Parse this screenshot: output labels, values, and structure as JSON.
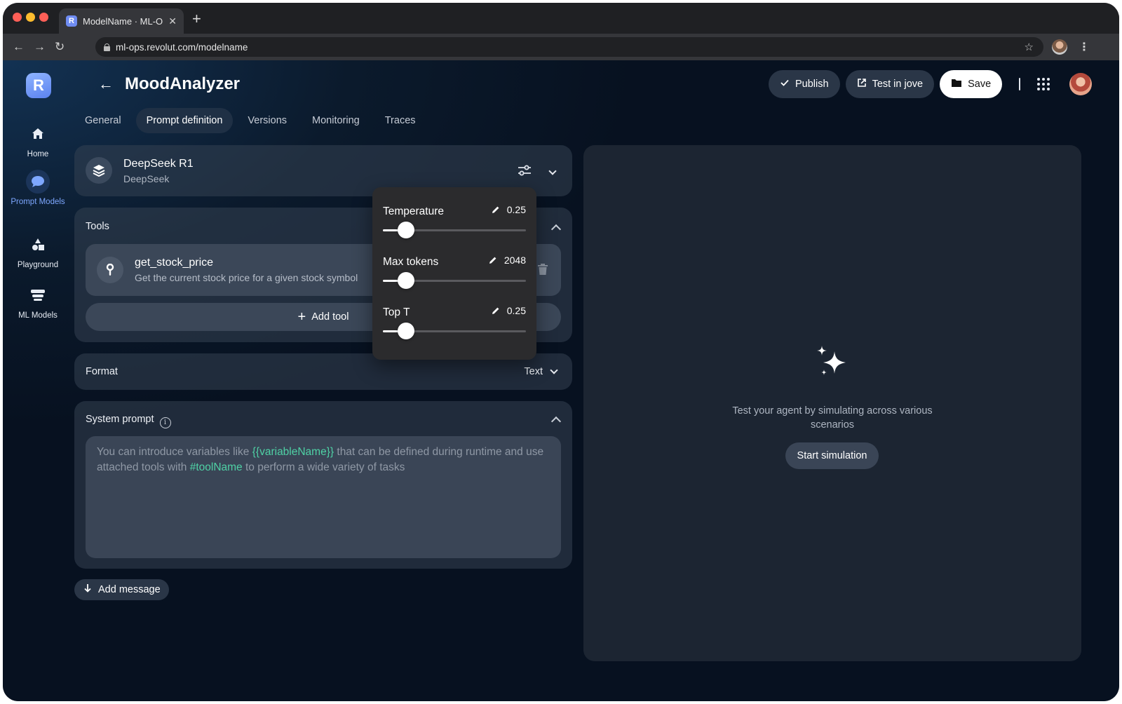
{
  "browser": {
    "tab_title": "ModelName · ML-Ops",
    "favicon_letter": "R",
    "url": "ml-ops.revolut.com/modelname",
    "new_tab": "+",
    "close_tab": "✕"
  },
  "sidebar": {
    "logo": "R",
    "items": [
      {
        "label": "Home",
        "icon": "home-icon"
      },
      {
        "label": "Prompt Models",
        "icon": "chat-bubble-icon",
        "active": true
      },
      {
        "label": "Playground",
        "icon": "shapes-icon"
      },
      {
        "label": "ML Models",
        "icon": "server-stack-icon"
      }
    ]
  },
  "header": {
    "title": "MoodAnalyzer",
    "actions": {
      "publish": "Publish",
      "test": "Test in jove",
      "save": "Save"
    }
  },
  "tabs": [
    {
      "label": "General"
    },
    {
      "label": "Prompt definition",
      "active": true
    },
    {
      "label": "Versions"
    },
    {
      "label": "Monitoring"
    },
    {
      "label": "Traces"
    }
  ],
  "model": {
    "name": "DeepSeek R1",
    "provider": "DeepSeek"
  },
  "tools": {
    "title": "Tools",
    "items": [
      {
        "name": "get_stock_price",
        "description": "Get the current stock price for a given stock symbol"
      }
    ],
    "add_label": "Add tool"
  },
  "format": {
    "title": "Format",
    "value": "Text"
  },
  "system_prompt": {
    "title": "System prompt",
    "placeholder_part1": "You can introduce variables like ",
    "variable_example": "{{variableName}}",
    "placeholder_part2": " that can be defined during runtime and use attached tools with ",
    "tool_example": "#toolName",
    "placeholder_part3": " to perform a wide variety of tasks"
  },
  "add_message": "Add message",
  "simulation": {
    "text": "Test your agent by simulating across various scenarios",
    "button": "Start simulation"
  },
  "parameters": [
    {
      "label": "Temperature",
      "value": "0.25",
      "fraction": 0.16
    },
    {
      "label": "Max tokens",
      "value": "2048",
      "fraction": 0.16
    },
    {
      "label": "Top T",
      "value": "0.25",
      "fraction": 0.16
    }
  ],
  "colors": {
    "accent": "#7ea7ff",
    "highlight": "#4fd1a5",
    "background": "#0b1a2c"
  }
}
